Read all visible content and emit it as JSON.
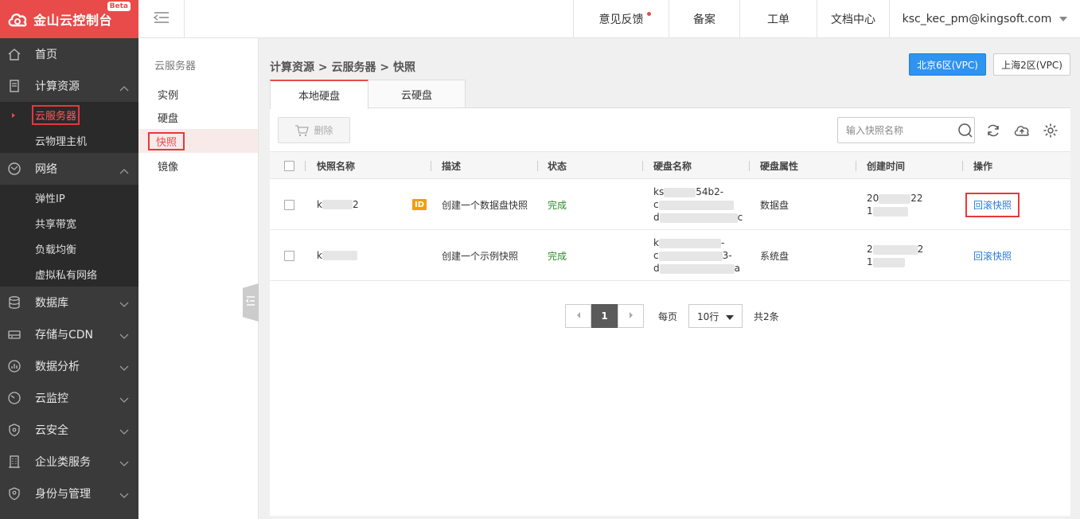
{
  "header": {
    "logo_text": "金山云控制台",
    "beta": "Beta",
    "links": {
      "feedback": "意见反馈",
      "beian": "备案",
      "ticket": "工单",
      "docs": "文档中心",
      "user": "ksc_kec_pm@kingsoft.com"
    }
  },
  "sidebar": {
    "home": "首页",
    "compute": "计算资源",
    "compute_items": [
      "云服务器",
      "云物理主机"
    ],
    "network": "网络",
    "network_items": [
      "弹性IP",
      "共享带宽",
      "负载均衡",
      "虚拟私有网络"
    ],
    "database": "数据库",
    "storage": "存储与CDN",
    "analytics": "数据分析",
    "monitor": "云监控",
    "security": "云安全",
    "enterprise": "企业类服务",
    "iam": "身份与管理"
  },
  "secondary": {
    "title": "云服务器",
    "items": [
      "实例",
      "硬盘",
      "快照",
      "镜像"
    ]
  },
  "main": {
    "breadcrumb": "计算资源 > 云服务器 > 快照",
    "regions": [
      "北京6区(VPC)",
      "上海2区(VPC)"
    ],
    "tabs": [
      "本地硬盘",
      "云硬盘"
    ],
    "delete_label": "删除",
    "search_placeholder": "输入快照名称",
    "columns": [
      "快照名称",
      "描述",
      "状态",
      "硬盘名称",
      "硬盘属性",
      "创建时间",
      "操作"
    ],
    "rows": [
      {
        "name_a": "k",
        "name_b": "2",
        "badge": "ID",
        "desc": "创建一个数据盘快照",
        "status": "完成",
        "disk_l1a": "ks",
        "disk_l1b": "54b2-",
        "disk_l2a": "c",
        "disk_l3a": "d",
        "disk_l3b": "c",
        "attr": "数据盘",
        "time_l1a": "20",
        "time_l1b": "22",
        "time_l2a": "1",
        "action": "回滚快照"
      },
      {
        "name_a": "k",
        "desc": "创建一个示例快照",
        "status": "完成",
        "disk_l1a": "k",
        "disk_l1b": "-",
        "disk_l2a": "c",
        "disk_l2b": "3-",
        "disk_l3a": "d",
        "disk_l3b": "a",
        "attr": "系统盘",
        "time_l1a": "2",
        "time_l1b": "2",
        "time_l2a": "1",
        "action": "回滚快照"
      }
    ],
    "pager": {
      "current": "1",
      "per_page_label": "每页",
      "per_page": "10行",
      "total": "共2条"
    }
  }
}
